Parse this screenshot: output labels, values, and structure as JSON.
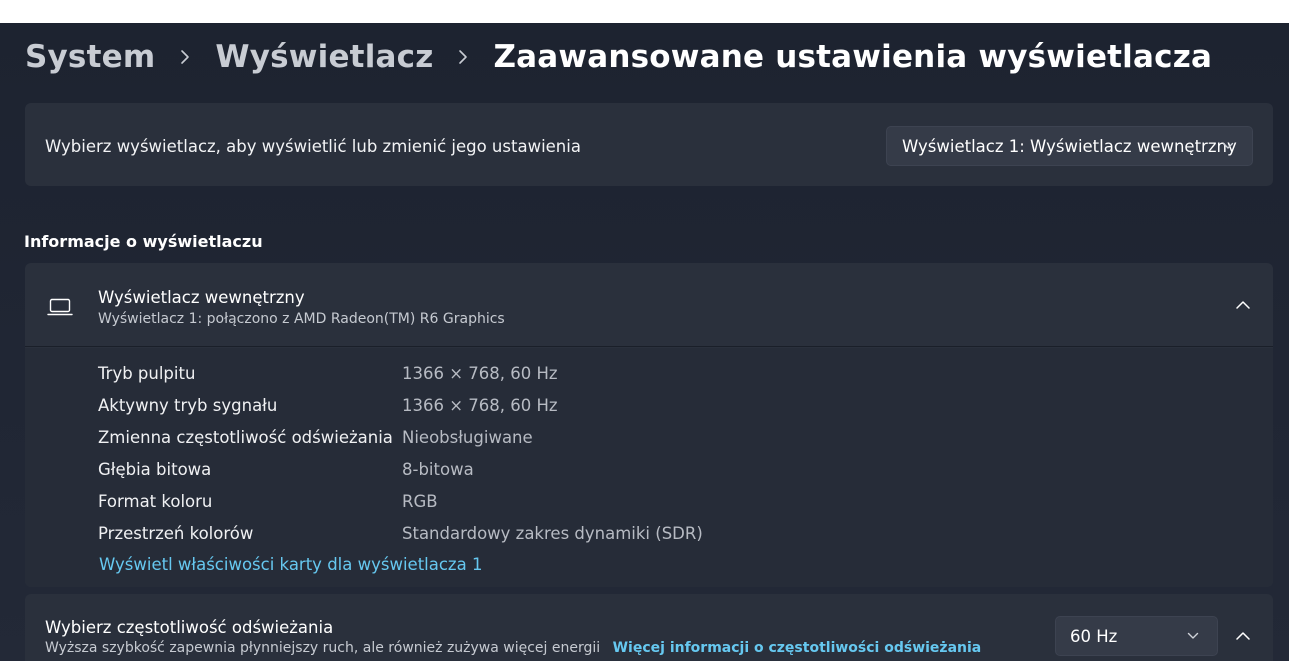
{
  "breadcrumb": {
    "items": [
      "System",
      "Wyświetlacz"
    ],
    "current": "Zaawansowane ustawienia wyświetlacza"
  },
  "display_selector": {
    "label": "Wybierz wyświetlacz, aby wyświetlić lub zmienić jego ustawienia",
    "selected": "Wyświetlacz 1: Wyświetlacz wewnętrzny"
  },
  "display_info": {
    "section_title": "Informacje o wyświetlaczu",
    "title": "Wyświetlacz wewnętrzny",
    "subtitle": "Wyświetlacz 1: połączono z AMD Radeon(TM) R6 Graphics",
    "properties": [
      {
        "label": "Tryb pulpitu",
        "value": "1366 × 768, 60 Hz"
      },
      {
        "label": "Aktywny tryb sygnału",
        "value": "1366 × 768, 60 Hz"
      },
      {
        "label": "Zmienna częstotliwość odświeżania",
        "value": "Nieobsługiwane"
      },
      {
        "label": "Głębia bitowa",
        "value": "8-bitowa"
      },
      {
        "label": "Format koloru",
        "value": "RGB"
      },
      {
        "label": "Przestrzeń kolorów",
        "value": "Standardowy zakres dynamiki (SDR)"
      }
    ],
    "adapter_link": "Wyświetl właściwości karty dla wyświetlacza 1"
  },
  "refresh_rate": {
    "title": "Wybierz częstotliwość odświeżania",
    "description": "Wyższa szybkość zapewnia płynniejszy ruch, ale również zużywa więcej energii",
    "more_info_link": "Więcej informacji o częstotliwości odświeżania",
    "selected": "60 Hz"
  },
  "colors": {
    "background": "#1f2533",
    "card": "#2a303c",
    "link": "#66c8f0"
  }
}
